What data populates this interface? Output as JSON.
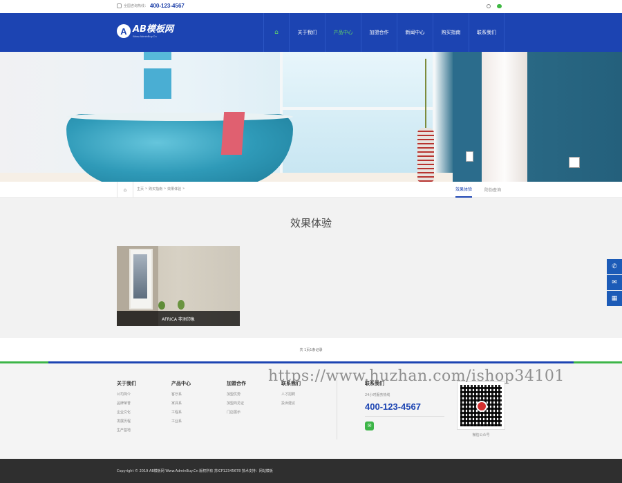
{
  "topbar": {
    "hotline_label": "全国咨询热线：",
    "hotline_number": "400-123-4567",
    "icons": [
      "phone-icon",
      "search-icon",
      "wechat-icon"
    ]
  },
  "nav": {
    "logo_text": "AB模板网",
    "logo_sub": "Www.AdminBuy.Cn",
    "items": [
      {
        "label": "⌂",
        "icon": "home-icon"
      },
      {
        "label": "关于我们"
      },
      {
        "label": "产品中心",
        "active": true
      },
      {
        "label": "加盟合作"
      },
      {
        "label": "新闻中心"
      },
      {
        "label": "购买指南"
      },
      {
        "label": "联系我们"
      }
    ]
  },
  "breadcrumb": {
    "items": [
      "主页",
      "»",
      "购买指南",
      "»",
      "效果体验",
      "»"
    ]
  },
  "subtabs": [
    {
      "label": "效果体验",
      "active": true
    },
    {
      "label": "防伪查询"
    }
  ],
  "main": {
    "heading": "效果体验",
    "cards": [
      {
        "caption": "AFRICA 非洲印象"
      }
    ],
    "pager": "共 1页1条记录"
  },
  "footer": {
    "columns": [
      {
        "title": "关于我们",
        "links": [
          "公司简介",
          "品牌荣誉",
          "企业文化",
          "发展历程",
          "生产基地"
        ]
      },
      {
        "title": "产品中心",
        "links": [
          "客厅系",
          "家具系",
          "工程系",
          "工业系"
        ]
      },
      {
        "title": "加盟合作",
        "links": [
          "加盟优势",
          "加盟商见证",
          "门店展示"
        ]
      },
      {
        "title": "联系我们",
        "links": [
          "人才招聘",
          "投诉建议"
        ]
      }
    ],
    "contact": {
      "title": "联系我们",
      "service_label": "24小时服务热线",
      "phone": "400-123-4567"
    },
    "qr_caption": "微信公众号",
    "watermark": "https://www.huzhan.com/ishop34101",
    "copyright": "Copyright © 2019 AB模板网 Www.AdminBuy.Cn 版权所有   苏ICP12345678   技术支持：网站模板"
  },
  "side_buttons": [
    "phone-icon",
    "mail-icon",
    "qrcode-icon"
  ],
  "colors": {
    "brand_blue": "#1c44b2",
    "accent_green": "#61d468",
    "footer_dark": "#2f2f2f"
  }
}
